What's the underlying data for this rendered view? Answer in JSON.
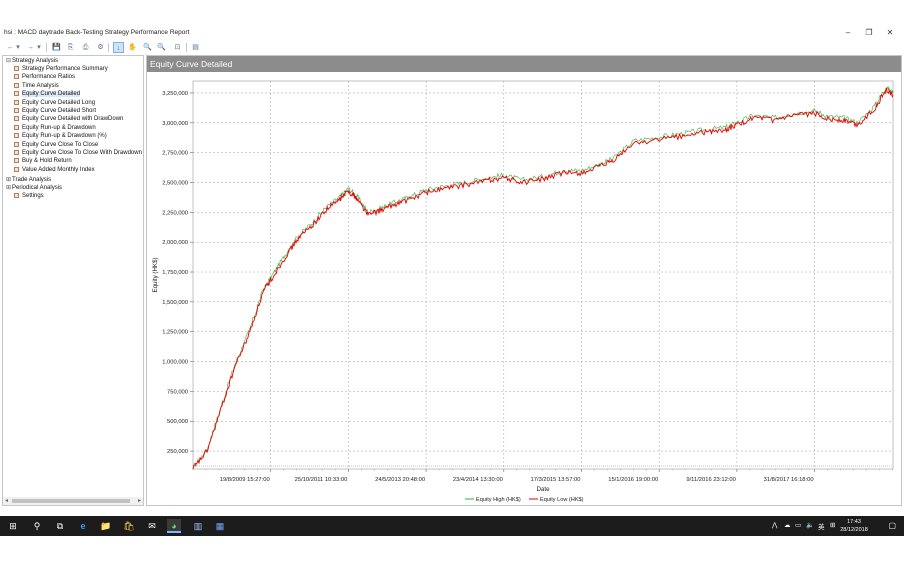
{
  "window": {
    "title": "hsi : MACD daytrade Back-Testing Strategy Performance Report",
    "minimize": "–",
    "restore": "❐",
    "close": "✕"
  },
  "toolbar": {
    "back": "←",
    "back_menu": "▾",
    "forward": "→",
    "forward_menu": "▾",
    "save": "💾",
    "copy": "⎘",
    "print": "⎙",
    "settings": "⚙",
    "pointer": "↓",
    "pan": "✋",
    "zoom_in": "🔍",
    "zoom_out": "🔍",
    "fit": "⊡",
    "export": "▤"
  },
  "tree": {
    "root": "Strategy Analysis",
    "items": [
      "Strategy Performance Summary",
      "Performance Ratios",
      "Time Analysis",
      "Equity Curve Detailed",
      "Equity Curve Detailed Long",
      "Equity Curve Detailed Short",
      "Equity Curve Detailed with DrawDown",
      "Equity Run-up & Drawdown",
      "Equity Run-up & Drawdown (%)",
      "Equity Curve Close To Close",
      "Equity Curve Close To Close With Drawdown",
      "Buy & Hold Return",
      "Value Added Monthly Index"
    ],
    "selected_index": 3,
    "trade_analysis": "Trade Analysis",
    "periodical_analysis": "Periodical Analysis",
    "settings": "Settings"
  },
  "chart": {
    "header": "Equity Curve Detailed"
  },
  "chart_data": {
    "type": "line",
    "xlabel": "Date",
    "ylabel": "Equity (HK$)",
    "ylim": [
      100000,
      3350000
    ],
    "yticks": [
      250000,
      500000,
      750000,
      1000000,
      1250000,
      1500000,
      1750000,
      2000000,
      2250000,
      2500000,
      2750000,
      3000000,
      3250000
    ],
    "ytick_labels": [
      "250,000",
      "500,000",
      "750,000",
      "1,000,000",
      "1,250,000",
      "1,500,000",
      "1,750,000",
      "2,000,000",
      "2,250,000",
      "2,500,000",
      "2,750,000",
      "3,000,000",
      "3,250,000"
    ],
    "xlim": [
      0,
      1000
    ],
    "xticks": [
      111,
      222,
      333,
      444,
      555,
      666,
      777,
      888
    ],
    "xtick_labels": [
      "19/8/2009 15:27:00",
      "25/10/2011 10:33:00",
      "24/5/2013 20:48:00",
      "23/4/2014 13:30:00",
      "17/3/2015 13:57:00",
      "15/1/2016 19:00:00",
      "9/11/2016 23:12:00",
      "31/8/2017 16:18:00"
    ],
    "grid": true,
    "legend_position": "bottom-center",
    "series": [
      {
        "name": "Equity High (HK$)",
        "color": "#3caa3c",
        "x": [
          0,
          20,
          40,
          60,
          80,
          100,
          111,
          130,
          150,
          170,
          190,
          210,
          222,
          235,
          250,
          270,
          290,
          310,
          333,
          360,
          390,
          420,
          444,
          470,
          500,
          530,
          555,
          580,
          600,
          630,
          666,
          700,
          730,
          760,
          777,
          800,
          830,
          860,
          888,
          910,
          930,
          950,
          975,
          990,
          1000
        ],
        "y": [
          110000,
          260000,
          620000,
          980000,
          1250000,
          1600000,
          1700000,
          1880000,
          2050000,
          2160000,
          2290000,
          2380000,
          2450000,
          2380000,
          2250000,
          2290000,
          2340000,
          2380000,
          2440000,
          2470000,
          2500000,
          2540000,
          2560000,
          2520000,
          2550000,
          2600000,
          2600000,
          2650000,
          2700000,
          2850000,
          2880000,
          2910000,
          2940000,
          2960000,
          3000000,
          3060000,
          3040000,
          3080000,
          3100000,
          3050000,
          3040000,
          3000000,
          3150000,
          3300000,
          3250000
        ]
      },
      {
        "name": "Equity Low (HK$)",
        "color": "#e60000",
        "x": [
          0,
          20,
          40,
          60,
          80,
          100,
          111,
          130,
          150,
          170,
          190,
          210,
          222,
          235,
          250,
          270,
          290,
          310,
          333,
          360,
          390,
          420,
          444,
          470,
          500,
          530,
          555,
          580,
          600,
          630,
          666,
          700,
          730,
          760,
          777,
          800,
          830,
          860,
          888,
          910,
          930,
          950,
          975,
          990,
          1000
        ],
        "y": [
          100000,
          250000,
          600000,
          960000,
          1230000,
          1580000,
          1680000,
          1860000,
          2030000,
          2140000,
          2270000,
          2360000,
          2430000,
          2360000,
          2230000,
          2270000,
          2320000,
          2360000,
          2420000,
          2450000,
          2480000,
          2520000,
          2540000,
          2500000,
          2530000,
          2580000,
          2580000,
          2630000,
          2680000,
          2830000,
          2860000,
          2890000,
          2920000,
          2940000,
          2980000,
          3040000,
          3020000,
          3060000,
          3080000,
          3030000,
          3020000,
          2980000,
          3130000,
          3280000,
          3230000
        ]
      }
    ]
  },
  "taskbar": {
    "start": "⊞",
    "search": "⚲",
    "taskview": "⧉",
    "edge": "e",
    "explorer": "📁",
    "store": "🛍",
    "mail": "✉",
    "app1": "◕",
    "app2": "▥",
    "app3": "▦",
    "tray_up": "⋀",
    "cloud": "☁",
    "network": "▭",
    "volume": "🔈",
    "ime": "英",
    "ime2": "⊞",
    "time": "17:43",
    "date": "28/12/2018",
    "notify": "▢"
  }
}
